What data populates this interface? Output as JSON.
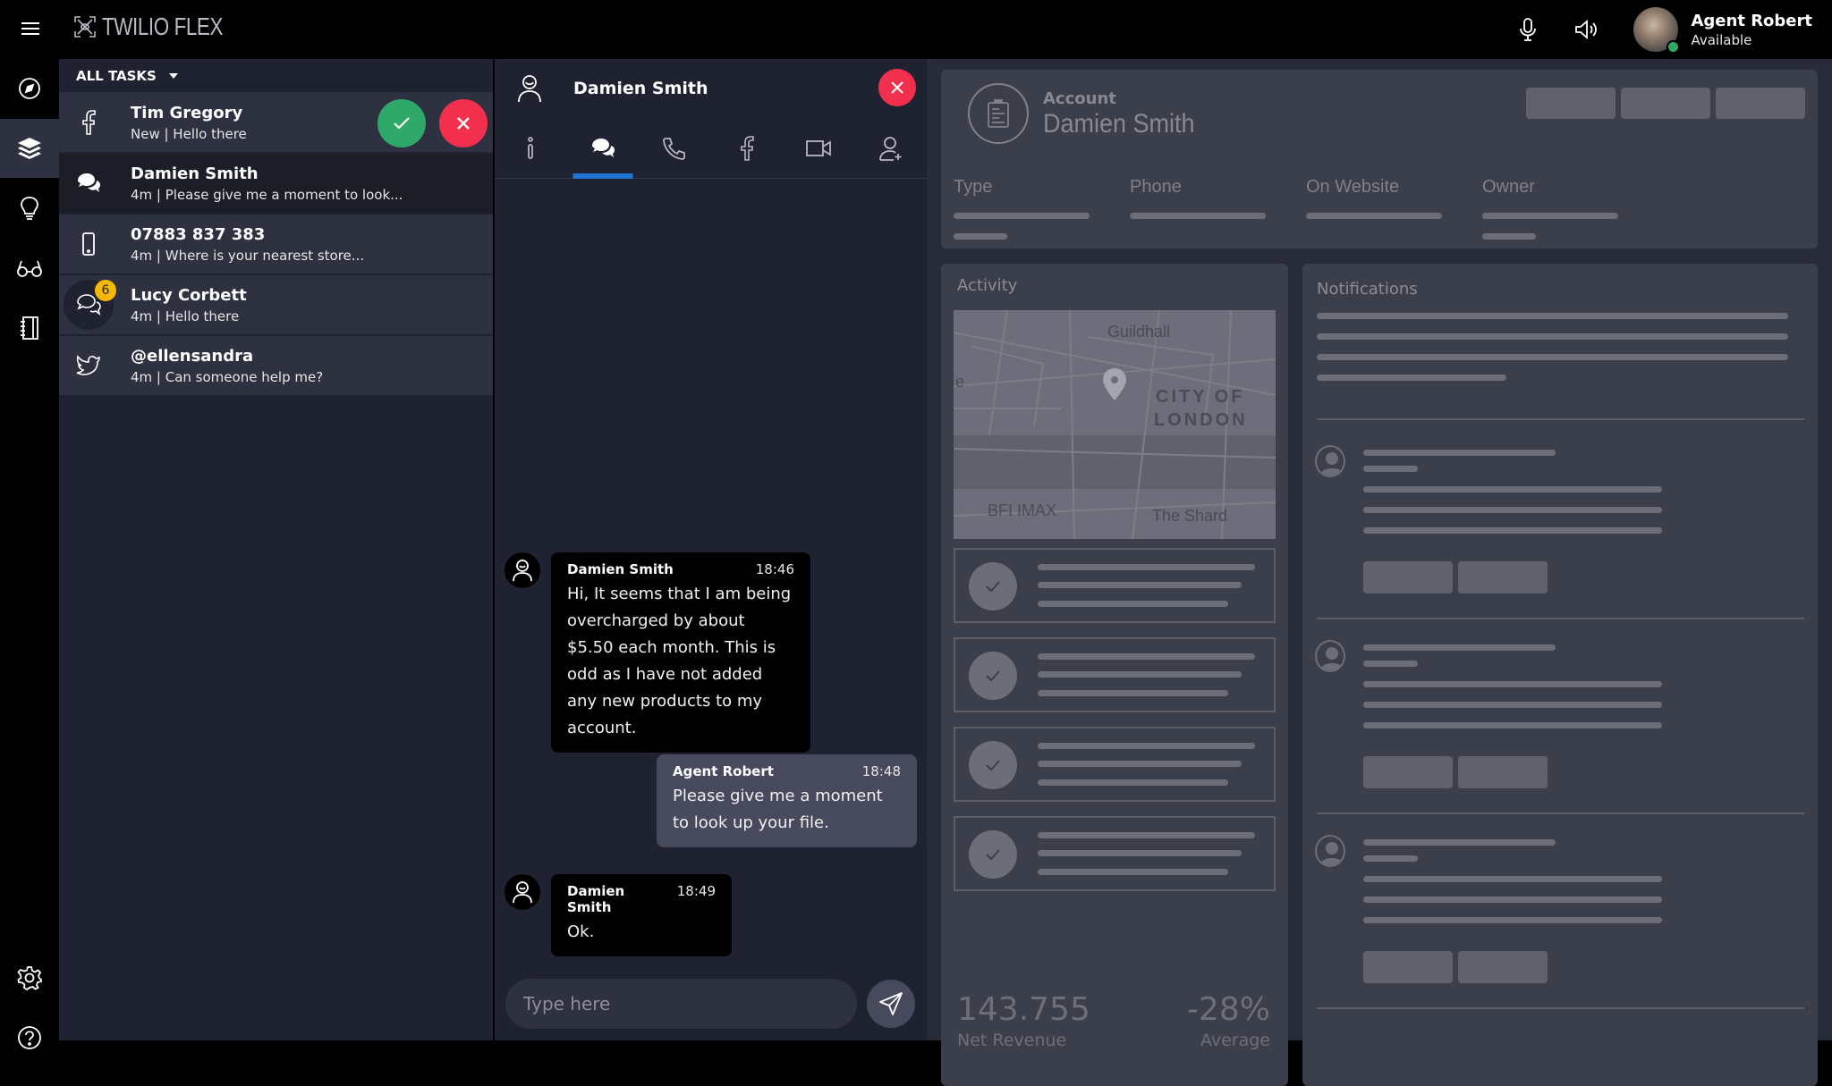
{
  "app": {
    "title": "TWILIO FLEX"
  },
  "agent": {
    "name": "Agent Robert",
    "status": "Available",
    "status_color": "#2faa64"
  },
  "nav": {
    "items": [
      {
        "icon": "compass-icon",
        "active": false
      },
      {
        "icon": "layers-icon",
        "active": true
      },
      {
        "icon": "lightbulb-icon",
        "active": false
      },
      {
        "icon": "glasses-icon",
        "active": false
      },
      {
        "icon": "notebook-icon",
        "active": false
      }
    ],
    "bottom": [
      {
        "icon": "gear-icon"
      },
      {
        "icon": "help-icon"
      }
    ]
  },
  "tasks": {
    "filter_label": "ALL TASKS",
    "items": [
      {
        "channel": "facebook-icon",
        "title": "Tim Gregory",
        "subtitle": "New | Hello there",
        "state": "incoming"
      },
      {
        "channel": "chat-icon",
        "title": "Damien Smith",
        "subtitle": "4m | Please give me a moment to look...",
        "state": "selected"
      },
      {
        "channel": "phone-icon",
        "title": "07883 837 383",
        "subtitle": "4m | Where is your nearest store...",
        "state": "normal"
      },
      {
        "channel": "chat-outline-icon",
        "title": "Lucy Corbett",
        "subtitle": "4m | Hello there",
        "state": "normal",
        "badge": "6"
      },
      {
        "channel": "twitter-icon",
        "title": "@ellensandra",
        "subtitle": "4m | Can someone help me?",
        "state": "normal"
      }
    ]
  },
  "chat": {
    "contact_name": "Damien Smith",
    "tabs": [
      {
        "icon": "info-icon",
        "active": false
      },
      {
        "icon": "chat-icon",
        "active": true
      },
      {
        "icon": "phone-call-icon",
        "active": false
      },
      {
        "icon": "facebook-icon",
        "active": false
      },
      {
        "icon": "video-icon",
        "active": false
      },
      {
        "icon": "add-user-icon",
        "active": false
      }
    ],
    "messages": [
      {
        "author": "Damien Smith",
        "time": "18:46",
        "direction": "inbound",
        "text": "Hi, It seems that I am being overcharged by about $5.50 each month. This is odd as I have not added any new products to my account."
      },
      {
        "author": "Agent Robert",
        "time": "18:48",
        "direction": "outbound",
        "text": "Please give me a moment to look up your file."
      },
      {
        "author": "Damien Smith",
        "time": "18:49",
        "direction": "inbound",
        "text": "Ok."
      }
    ],
    "composer_placeholder": "Type here"
  },
  "crm": {
    "account_label": "Account",
    "account_name": "Damien Smith",
    "fields": [
      "Type",
      "Phone",
      "On Website",
      "Owner"
    ],
    "activity_title": "Activity",
    "map_labels": {
      "guildhall": "Guildhall",
      "city": "CITY OF",
      "city2": "LONDON",
      "bfi": "BFI IMAX",
      "shard": "The Shard",
      "edge": "e"
    },
    "stats": {
      "net_revenue_value": "143.755",
      "net_revenue_label": "Net Revenue",
      "average_value": "-28%",
      "average_label": "Average"
    },
    "notifications_title": "Notifications"
  },
  "colors": {
    "accept": "#2ea96a",
    "reject": "#f2304d",
    "active_tab": "#1f74d4",
    "badge": "#f5b800"
  }
}
